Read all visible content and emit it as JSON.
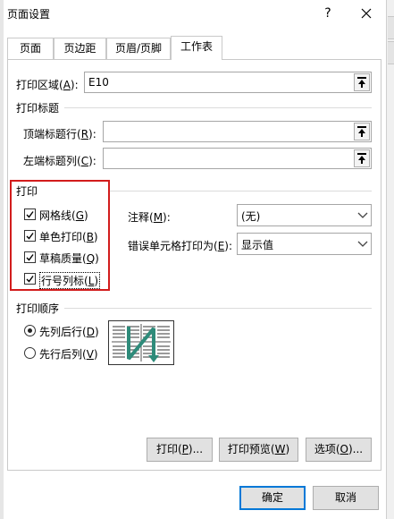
{
  "window": {
    "title": "页面设置",
    "help_label": "?"
  },
  "tabs": [
    {
      "label": "页面"
    },
    {
      "label": "页边距"
    },
    {
      "label": "页眉/页脚"
    },
    {
      "label": "工作表",
      "active": true
    }
  ],
  "print_area": {
    "label_text": "打印区域(",
    "label_key": "A",
    "label_suffix": "):",
    "value": "E10"
  },
  "print_titles": {
    "heading": "打印标题",
    "rows_label_text": "顶端标题行(",
    "rows_label_key": "R",
    "rows_label_suffix": "):",
    "rows_value": "",
    "cols_label_text": "左端标题列(",
    "cols_label_key": "C",
    "cols_label_suffix": "):",
    "cols_value": ""
  },
  "print": {
    "heading": "打印",
    "checkboxes": [
      {
        "text": "网格线(",
        "key": "G",
        "suffix": ")",
        "checked": true
      },
      {
        "text": "单色打印(",
        "key": "B",
        "suffix": ")",
        "checked": true
      },
      {
        "text": "草稿质量(",
        "key": "Q",
        "suffix": ")",
        "checked": true
      },
      {
        "text": "行号列标(",
        "key": "L",
        "suffix": ")",
        "checked": true
      }
    ],
    "comments_label_text": "注释(",
    "comments_label_key": "M",
    "comments_label_suffix": "):",
    "comments_value": "(无)",
    "errors_label_text": "错误单元格打印为(",
    "errors_label_key": "E",
    "errors_label_suffix": "):",
    "errors_value": "显示值"
  },
  "print_order": {
    "heading": "打印顺序",
    "options": [
      {
        "text": "先列后行(",
        "key": "D",
        "suffix": ")",
        "selected": true
      },
      {
        "text": "先行后列(",
        "key": "V",
        "suffix": ")",
        "selected": false
      }
    ]
  },
  "buttons": {
    "print_text": "打印(",
    "print_key": "P",
    "print_suffix": ")...",
    "preview_text": "打印预览(",
    "preview_key": "W",
    "preview_suffix": ")",
    "options_text": "选项(",
    "options_key": "O",
    "options_suffix": ")...",
    "ok": "确定",
    "cancel": "取消"
  },
  "colors": {
    "highlight": "#d21c1c",
    "accent": "#0078d7",
    "arrow": "#2e8b7a"
  }
}
